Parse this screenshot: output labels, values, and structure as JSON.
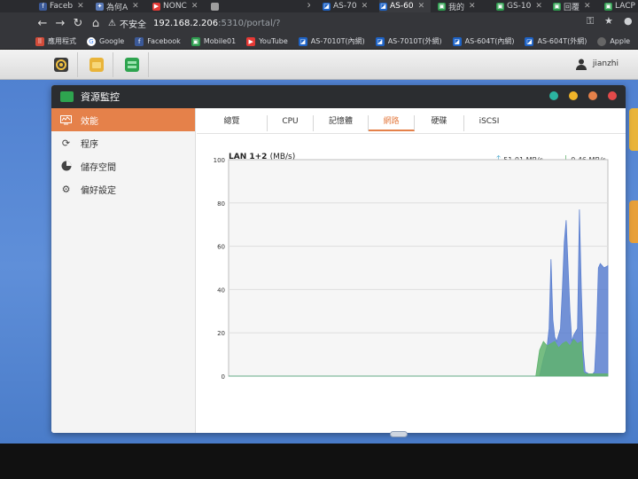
{
  "browser": {
    "tabs": [
      {
        "label": "Faceb",
        "color": "#3b5998",
        "glyph": "f"
      },
      {
        "label": "為何A",
        "color": "#5b7bb8",
        "glyph": "✦"
      },
      {
        "label": "NONC",
        "color": "#e53935",
        "glyph": "▶"
      },
      {
        "label": "",
        "color": "#9e9e9e",
        "glyph": ""
      },
      {
        "label": "AS-70",
        "color": "#1e63c6",
        "glyph": "◪"
      },
      {
        "label": "AS-60",
        "color": "#1e63c6",
        "glyph": "◪"
      },
      {
        "label": "我的",
        "color": "#2e9d4f",
        "glyph": "▣"
      },
      {
        "label": "GS-10",
        "color": "#2e9d4f",
        "glyph": "▣"
      },
      {
        "label": "回覆",
        "color": "#2e9d4f",
        "glyph": "▣"
      },
      {
        "label": "LACP",
        "color": "#2e9d4f",
        "glyph": "▣"
      }
    ],
    "insecure_label": "不安全",
    "url_host": "192.168.2.206",
    "url_path": ":5310/portal/?",
    "bookmarks": [
      {
        "label": "應用程式",
        "color": "#888888",
        "glyph": "⋮⋮"
      },
      {
        "label": "Google",
        "color": "#4285f4",
        "glyph": "G"
      },
      {
        "label": "Facebook",
        "color": "#3b5998",
        "glyph": "f"
      },
      {
        "label": "Mobile01",
        "color": "#2e9d4f",
        "glyph": "▣"
      },
      {
        "label": "YouTube",
        "color": "#e53935",
        "glyph": "▶"
      },
      {
        "label": "AS-7010T(內網)",
        "color": "#1e63c6",
        "glyph": "◪"
      },
      {
        "label": "AS-7010T(外網)",
        "color": "#1e63c6",
        "glyph": "◪"
      },
      {
        "label": "AS-604T(內網)",
        "color": "#1e63c6",
        "glyph": "◪"
      },
      {
        "label": "AS-604T(外網)",
        "color": "#1e63c6",
        "glyph": "◪"
      },
      {
        "label": "Apple",
        "color": "#555555",
        "glyph": ""
      }
    ]
  },
  "taskbar": {
    "username": "jianzhi"
  },
  "window": {
    "title": "資源監控",
    "dots": [
      "#2bb3a0",
      "#f0b429",
      "#e5814a",
      "#e34a4a"
    ]
  },
  "sidebar": {
    "items": [
      {
        "label": "效能",
        "icon": "monitor-icon",
        "selected": true
      },
      {
        "label": "程序",
        "icon": "refresh-icon",
        "selected": false
      },
      {
        "label": "儲存空間",
        "icon": "pie-icon",
        "selected": false
      },
      {
        "label": "偏好設定",
        "icon": "gear-icon",
        "selected": false
      }
    ]
  },
  "tabs": [
    {
      "label": "總覽",
      "selected": false
    },
    {
      "label": "CPU",
      "selected": false
    },
    {
      "label": "記憶體",
      "selected": false
    },
    {
      "label": "網路",
      "selected": true
    },
    {
      "label": "硬碟",
      "selected": false
    },
    {
      "label": "iSCSI",
      "selected": false
    }
  ],
  "chart_data": {
    "type": "area",
    "title": "LAN 1+2",
    "unit": "(MB/s)",
    "ylim": [
      0,
      100
    ],
    "yticks": [
      0,
      20,
      40,
      60,
      80,
      100
    ],
    "grid": true,
    "upload_label": "51.01 MB/s",
    "download_label": "0.46 MB/s",
    "colors": {
      "upload": "#5b7fd0",
      "download": "#5fb36d"
    },
    "series": [
      {
        "name": "upload",
        "x": [
          0,
          0.82,
          0.83,
          0.84,
          0.845,
          0.85,
          0.855,
          0.86,
          0.865,
          0.875,
          0.88,
          0.885,
          0.89,
          0.9,
          0.905,
          0.91,
          0.92,
          0.925,
          0.93,
          0.935,
          0.94,
          0.95,
          0.955,
          0.96,
          0.965,
          0.97,
          0.975,
          0.98,
          0.985,
          0.99,
          1.0
        ],
        "values": [
          0,
          0,
          8,
          14,
          22,
          54,
          26,
          18,
          16,
          22,
          40,
          62,
          72,
          30,
          16,
          19,
          22,
          77,
          40,
          12,
          2,
          1,
          1,
          1,
          2,
          20,
          50,
          52,
          51,
          50,
          51
        ]
      },
      {
        "name": "download",
        "x": [
          0,
          0.81,
          0.82,
          0.83,
          0.84,
          0.85,
          0.86,
          0.87,
          0.88,
          0.89,
          0.9,
          0.91,
          0.92,
          0.93,
          0.935,
          0.94,
          0.945,
          1.0
        ],
        "values": [
          0,
          0,
          12,
          16,
          14,
          15,
          16,
          13,
          15,
          16,
          14,
          17,
          15,
          16,
          2,
          1,
          1,
          1
        ]
      }
    ]
  }
}
